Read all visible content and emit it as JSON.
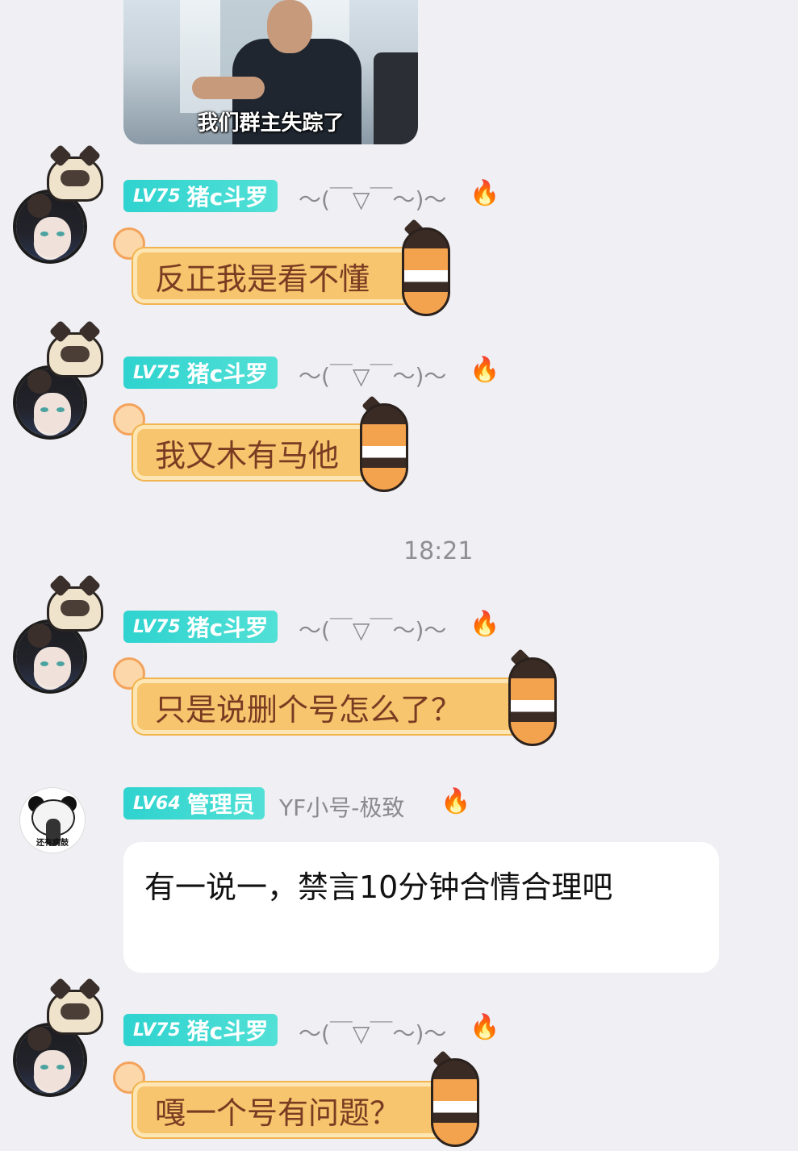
{
  "image_message": {
    "caption": "我们群主失踪了"
  },
  "time_divider": "18:21",
  "colors": {
    "badge_bg": "#2fd3cf",
    "bubble_bg": "#f7c56d",
    "bubble_text": "#7a3b23",
    "background": "#efeff4"
  },
  "messages": [
    {
      "level": "LV75",
      "title": "猪c斗罗",
      "nickname": "～(￣▽￣～)～",
      "flame": "🔥",
      "text": "反正我是看不懂"
    },
    {
      "level": "LV75",
      "title": "猪c斗罗",
      "nickname": "～(￣▽￣～)～",
      "flame": "🔥",
      "text": "我又木有马他"
    },
    {
      "level": "LV75",
      "title": "猪c斗罗",
      "nickname": "～(￣▽￣～)～",
      "flame": "🔥",
      "text": "只是说删个号怎么了？"
    },
    {
      "level": "LV64",
      "title": "管理员",
      "nickname": "YF小号-极致",
      "flame": "🔥",
      "text": "有一说一，禁言10分钟合情合理吧",
      "avatar_text": "还有病鼓"
    },
    {
      "level": "LV75",
      "title": "猪c斗罗",
      "nickname": "～(￣▽￣～)～",
      "flame": "🔥",
      "text": "嘎一个号有问题？"
    }
  ]
}
